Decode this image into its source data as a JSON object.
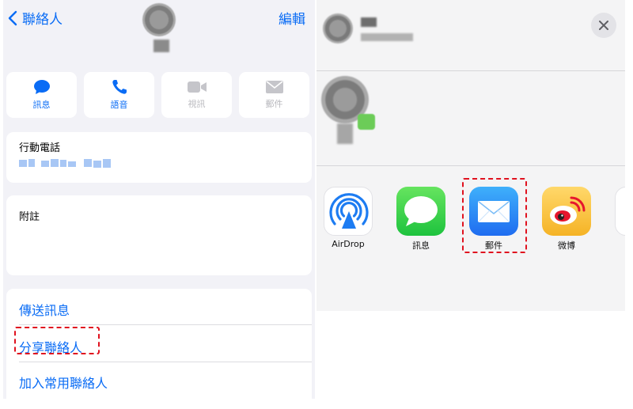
{
  "contact_card": {
    "back_label": "聯絡人",
    "edit_label": "編輯",
    "actions": [
      {
        "label": "訊息",
        "icon": "message-icon",
        "enabled": true
      },
      {
        "label": "語音",
        "icon": "phone-icon",
        "enabled": true
      },
      {
        "label": "視訊",
        "icon": "video-icon",
        "enabled": false
      },
      {
        "label": "郵件",
        "icon": "mail-icon",
        "enabled": false
      }
    ],
    "phone_label": "行動電話",
    "notes_label": "附註",
    "list": {
      "send_message": "傳送訊息",
      "share_contact": "分享聯絡人",
      "add_favorite": "加入常用聯絡人"
    }
  },
  "share_sheet": {
    "apps": [
      {
        "label": "AirDrop",
        "icon": "airdrop-icon"
      },
      {
        "label": "訊息",
        "icon": "messages-app-icon"
      },
      {
        "label": "郵件",
        "icon": "mail-app-icon"
      },
      {
        "label": "微博",
        "icon": "weibo-app-icon"
      }
    ]
  },
  "colors": {
    "accent": "#0a6cf5",
    "highlight": "#e0121f",
    "messages_green": "#3ec94e",
    "mail_blue": "#2b8df3",
    "weibo_yellow": "#f7c433"
  }
}
